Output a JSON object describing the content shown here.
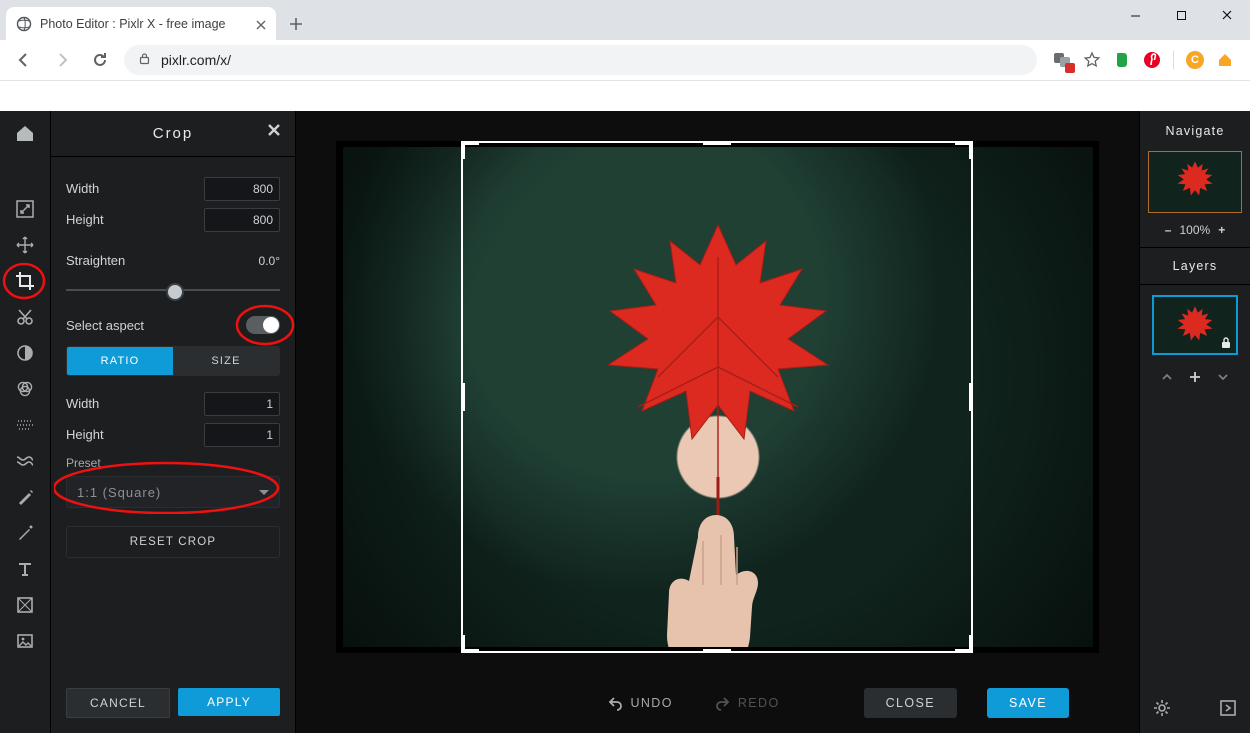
{
  "browser": {
    "tab_title": "Photo Editor : Pixlr X - free image",
    "url_display": "pixlr.com/x/"
  },
  "panel": {
    "title": "Crop",
    "width_label": "Width",
    "width_value": "800",
    "height_label": "Height",
    "height_value": "800",
    "straighten_label": "Straighten",
    "straighten_value": "0.0°",
    "select_aspect_label": "Select aspect",
    "ratio_label": "RATIO",
    "size_label": "SIZE",
    "ratio_width_label": "Width",
    "ratio_width_value": "1",
    "ratio_height_label": "Height",
    "ratio_height_value": "1",
    "preset_label": "Preset",
    "preset_value": "1:1 (Square)",
    "reset_label": "RESET CROP",
    "cancel_label": "CANCEL",
    "apply_label": "APPLY"
  },
  "bottombar": {
    "undo": "UNDO",
    "redo": "REDO",
    "close": "CLOSE",
    "save": "SAVE"
  },
  "right": {
    "navigate": "Navigate",
    "zoom": "100%",
    "layers": "Layers"
  }
}
